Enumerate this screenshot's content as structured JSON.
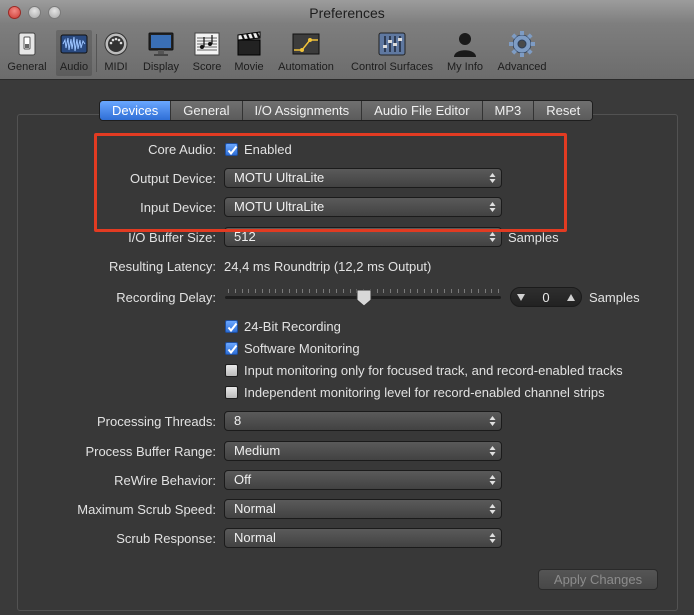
{
  "window": {
    "title": "Preferences"
  },
  "toolbar": {
    "items": [
      {
        "label": "General",
        "icon": "switch-icon"
      },
      {
        "label": "Audio",
        "icon": "waveform-icon"
      },
      {
        "label": "MIDI",
        "icon": "midi-connector-icon"
      },
      {
        "label": "Display",
        "icon": "monitor-icon"
      },
      {
        "label": "Score",
        "icon": "sheet-music-icon"
      },
      {
        "label": "Movie",
        "icon": "clapperboard-icon"
      },
      {
        "label": "Automation",
        "icon": "automation-curve-icon"
      },
      {
        "label": "Control Surfaces",
        "icon": "faders-icon"
      },
      {
        "label": "My Info",
        "icon": "person-silhouette-icon"
      },
      {
        "label": "Advanced",
        "icon": "gear-icon"
      }
    ],
    "selected": "Audio"
  },
  "tabs": [
    "Devices",
    "General",
    "I/O Assignments",
    "Audio File Editor",
    "MP3",
    "Reset"
  ],
  "active_tab": "Devices",
  "form": {
    "core_audio": {
      "label": "Core Audio:",
      "checkbox_label": "Enabled",
      "checked": true
    },
    "output_device": {
      "label": "Output Device:",
      "value": "MOTU UltraLite"
    },
    "input_device": {
      "label": "Input Device:",
      "value": "MOTU UltraLite"
    },
    "io_buffer_size": {
      "label": "I/O Buffer Size:",
      "value": "512",
      "unit": "Samples"
    },
    "resulting_latency": {
      "label": "Resulting Latency:",
      "value": "24,4 ms Roundtrip (12,2 ms Output)"
    },
    "recording_delay": {
      "label": "Recording Delay:",
      "value": "0",
      "unit": "Samples",
      "slider_fraction": 0.5
    },
    "options": [
      {
        "label": "24-Bit Recording",
        "checked": true
      },
      {
        "label": "Software Monitoring",
        "checked": true
      },
      {
        "label": "Input monitoring only for focused track, and record-enabled tracks",
        "checked": false
      },
      {
        "label": "Independent monitoring level for record-enabled channel strips",
        "checked": false
      }
    ],
    "processing_threads": {
      "label": "Processing Threads:",
      "value": "8"
    },
    "process_buffer_range": {
      "label": "Process Buffer Range:",
      "value": "Medium"
    },
    "rewire_behavior": {
      "label": "ReWire Behavior:",
      "value": "Off"
    },
    "max_scrub_speed": {
      "label": "Maximum Scrub Speed:",
      "value": "Normal"
    },
    "scrub_response": {
      "label": "Scrub Response:",
      "value": "Normal"
    }
  },
  "apply_button": {
    "label": "Apply Changes",
    "enabled": false
  },
  "colors": {
    "accent": "#2f6fd6",
    "highlight": "#e23b22"
  }
}
